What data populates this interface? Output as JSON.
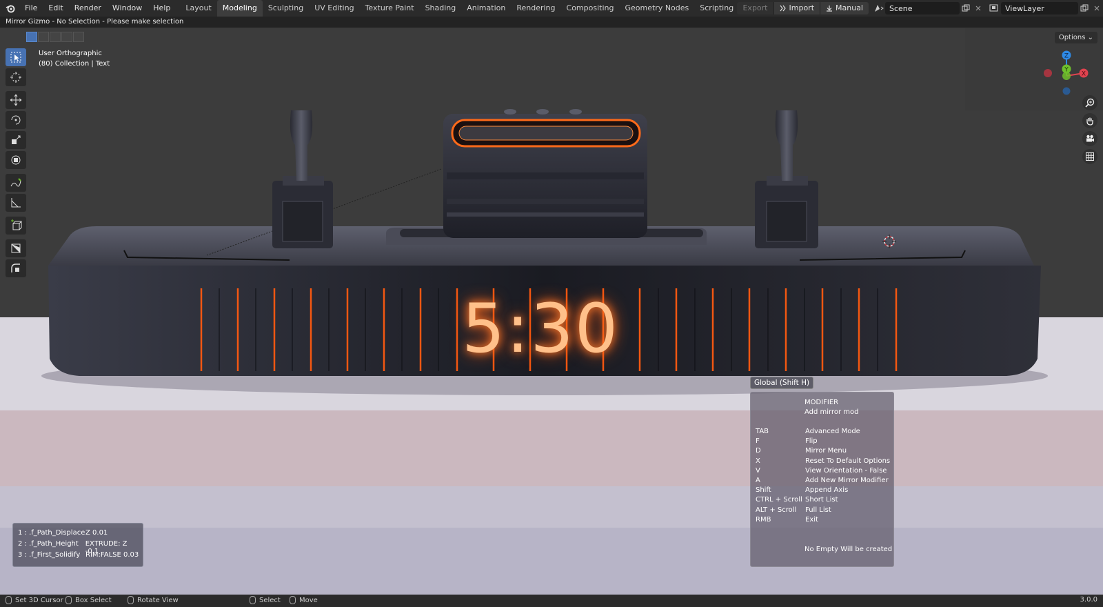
{
  "menu": [
    "File",
    "Edit",
    "Render",
    "Window",
    "Help"
  ],
  "workspaces": [
    "Layout",
    "Modeling",
    "Sculpting",
    "UV Editing",
    "Texture Paint",
    "Shading",
    "Animation",
    "Rendering",
    "Compositing",
    "Geometry Nodes",
    "Scripting"
  ],
  "active_workspace": "Modeling",
  "top_right": {
    "export": "Export",
    "import": "Import",
    "manual": "Manual",
    "scene": "Scene",
    "view_layer": "ViewLayer"
  },
  "operator_status": "Mirror Gizmo - No Selection - Please make selection",
  "viewport": {
    "view_name": "User Orthographic",
    "collection": "(80) Collection | Text",
    "options": "Options",
    "clock_text": "5:30"
  },
  "gizmo": {
    "x": "X",
    "y": "Y",
    "z": "Z"
  },
  "modifier_panel": [
    {
      "key": "1 : .f_Path_Displace",
      "value": "Z 0.01"
    },
    {
      "key": "2 : .f_Path_Height",
      "value": "EXTRUDE: Z -0.1"
    },
    {
      "key": "3 : .f_First_Solidify",
      "value": "RIM:FALSE 0.03"
    }
  ],
  "help": {
    "title": "Global (Shift H)",
    "header1": "MODIFIER",
    "header2": "Add mirror mod",
    "rows": [
      {
        "key": "TAB",
        "value": "Advanced Mode"
      },
      {
        "key": "F",
        "value": "Flip"
      },
      {
        "key": "D",
        "value": "Mirror Menu"
      },
      {
        "key": "X",
        "value": "Reset To Default Options"
      },
      {
        "key": "V",
        "value": "View Orientation - False"
      },
      {
        "key": "A",
        "value": "Add New Mirror Modifier"
      },
      {
        "key": "Shift",
        "value": "Append Axis"
      },
      {
        "key": "CTRL + Scroll",
        "value": "Short List"
      },
      {
        "key": "ALT + Scroll",
        "value": "Full List"
      },
      {
        "key": "RMB",
        "value": "Exit"
      }
    ],
    "footer": "No Empty Will be created"
  },
  "statusbar": {
    "set_cursor": "Set 3D Cursor",
    "box_select": "Box Select",
    "rotate_view": "Rotate View",
    "select": "Select",
    "move": "Move",
    "version": "3.0.0"
  },
  "colors": {
    "accent": "#4772b3",
    "glow": "#ff6a1a",
    "axis_x": "#e0434f",
    "axis_y": "#6ec02c",
    "axis_z": "#2e8ae6"
  }
}
